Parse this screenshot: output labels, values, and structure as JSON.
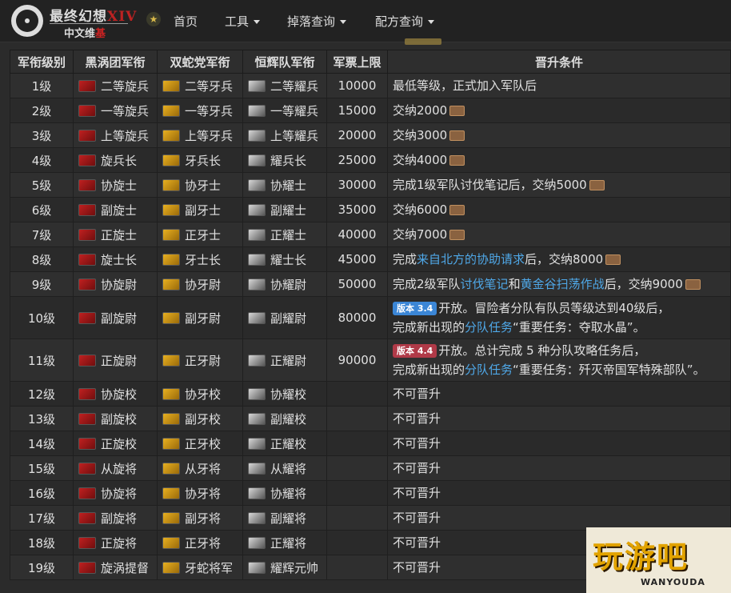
{
  "nav": {
    "brand_title": "最终幻想",
    "brand_title_suffix": "XIV",
    "brand_sub": "中文维",
    "brand_sub_red": "基",
    "theme_icon": "★",
    "items": [
      {
        "label": "首页",
        "has_dropdown": false
      },
      {
        "label": "工具",
        "has_dropdown": true
      },
      {
        "label": "掉落查询",
        "has_dropdown": true
      },
      {
        "label": "配方查询",
        "has_dropdown": true
      }
    ]
  },
  "table": {
    "headers": [
      "军衔级别",
      "黑涡团军衔",
      "双蛇党军衔",
      "恒辉队军衔",
      "军票上限",
      "晋升条件"
    ],
    "rows": [
      {
        "level": "1级",
        "r1": "二等旋兵",
        "r2": "二等牙兵",
        "r3": "二等耀兵",
        "cap": "10000",
        "cond": [
          {
            "t": "最低等级，正式加入军队后"
          }
        ]
      },
      {
        "level": "2级",
        "r1": "一等旋兵",
        "r2": "一等牙兵",
        "r3": "一等耀兵",
        "cap": "15000",
        "cond": [
          {
            "t": "交纳2000"
          },
          {
            "icon": "seal-icon"
          }
        ]
      },
      {
        "level": "3级",
        "r1": "上等旋兵",
        "r2": "上等牙兵",
        "r3": "上等耀兵",
        "cap": "20000",
        "cond": [
          {
            "t": "交纳3000"
          },
          {
            "icon": "seal-icon"
          }
        ]
      },
      {
        "level": "4级",
        "r1": "旋兵长",
        "r2": "牙兵长",
        "r3": "耀兵长",
        "cap": "25000",
        "cond": [
          {
            "t": "交纳4000"
          },
          {
            "icon": "seal-icon"
          }
        ]
      },
      {
        "level": "5级",
        "r1": "协旋士",
        "r2": "协牙士",
        "r3": "协耀士",
        "cap": "30000",
        "cond": [
          {
            "t": "完成1级军队讨伐笔记后，交纳5000"
          },
          {
            "icon": "seal-icon"
          }
        ]
      },
      {
        "level": "6级",
        "r1": "副旋士",
        "r2": "副牙士",
        "r3": "副耀士",
        "cap": "35000",
        "cond": [
          {
            "t": "交纳6000"
          },
          {
            "icon": "seal-icon"
          }
        ]
      },
      {
        "level": "7级",
        "r1": "正旋士",
        "r2": "正牙士",
        "r3": "正耀士",
        "cap": "40000",
        "cond": [
          {
            "t": "交纳7000"
          },
          {
            "icon": "seal-icon"
          }
        ]
      },
      {
        "level": "8级",
        "r1": "旋士长",
        "r2": "牙士长",
        "r3": "耀士长",
        "cap": "45000",
        "cond": [
          {
            "t": "完成"
          },
          {
            "link": "来自北方的协助请求"
          },
          {
            "t": "后，交纳8000"
          },
          {
            "icon": "seal-icon"
          }
        ]
      },
      {
        "level": "9级",
        "r1": "协旋尉",
        "r2": "协牙尉",
        "r3": "协耀尉",
        "cap": "50000",
        "cond": [
          {
            "t": "完成2级军队"
          },
          {
            "link": "讨伐笔记"
          },
          {
            "t": "和"
          },
          {
            "link": "黄金谷扫荡作战"
          },
          {
            "t": "后，交纳9000"
          },
          {
            "icon": "seal-icon"
          }
        ]
      },
      {
        "level": "10级",
        "r1": "副旋尉",
        "r2": "副牙尉",
        "r3": "副耀尉",
        "cap": "80000",
        "tall": true,
        "cond": [
          {
            "badge": "版本 3.4",
            "color": "blue"
          },
          {
            "t": "开放。冒险者分队有队员等级达到40级后，"
          },
          {
            "br": true
          },
          {
            "t": "完成新出现的"
          },
          {
            "link": "分队任务"
          },
          {
            "t": "“重要任务：夺取水晶”。"
          }
        ]
      },
      {
        "level": "11级",
        "r1": "正旋尉",
        "r2": "正牙尉",
        "r3": "正耀尉",
        "cap": "90000",
        "tall": true,
        "cond": [
          {
            "badge": "版本 4.4",
            "color": "red"
          },
          {
            "t": "开放。总计完成 5 种分队攻略任务后，"
          },
          {
            "br": true
          },
          {
            "t": "完成新出现的"
          },
          {
            "link": "分队任务"
          },
          {
            "t": "“重要任务：歼灭帝国军特殊部队”。"
          }
        ]
      },
      {
        "level": "12级",
        "r1": "协旋校",
        "r2": "协牙校",
        "r3": "协耀校",
        "cap": "",
        "cond": [
          {
            "t": "不可晋升"
          }
        ]
      },
      {
        "level": "13级",
        "r1": "副旋校",
        "r2": "副牙校",
        "r3": "副耀校",
        "cap": "",
        "cond": [
          {
            "t": "不可晋升"
          }
        ]
      },
      {
        "level": "14级",
        "r1": "正旋校",
        "r2": "正牙校",
        "r3": "正耀校",
        "cap": "",
        "cond": [
          {
            "t": "不可晋升"
          }
        ]
      },
      {
        "level": "15级",
        "r1": "从旋将",
        "r2": "从牙将",
        "r3": "从耀将",
        "cap": "",
        "cond": [
          {
            "t": "不可晋升"
          }
        ]
      },
      {
        "level": "16级",
        "r1": "协旋将",
        "r2": "协牙将",
        "r3": "协耀将",
        "cap": "",
        "cond": [
          {
            "t": "不可晋升"
          }
        ]
      },
      {
        "level": "17级",
        "r1": "副旋将",
        "r2": "副牙将",
        "r3": "副耀将",
        "cap": "",
        "cond": [
          {
            "t": "不可晋升"
          }
        ]
      },
      {
        "level": "18级",
        "r1": "正旋将",
        "r2": "正牙将",
        "r3": "正耀将",
        "cap": "",
        "cond": [
          {
            "t": "不可晋升"
          }
        ]
      },
      {
        "level": "19级",
        "r1": "旋涡提督",
        "r2": "牙蛇将军",
        "r3": "耀辉元帅",
        "cap": "",
        "cond": [
          {
            "t": "不可晋升"
          }
        ]
      }
    ]
  },
  "colors": {
    "link": "#4fa8e8",
    "badge_blue": "#3b86d6",
    "badge_red": "#b03a48",
    "maelstrom": "#c02020",
    "twin_adder": "#e8b020",
    "immortal_flames": "#d8d8d8"
  },
  "watermark": {
    "text": "玩游吧",
    "sub": "WANYOUDA"
  }
}
